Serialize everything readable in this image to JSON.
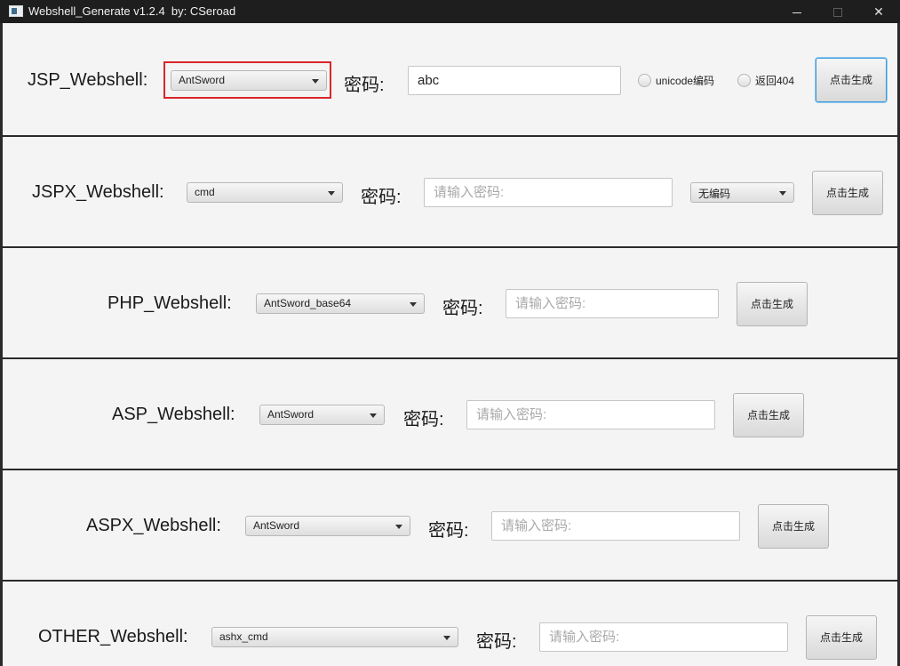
{
  "window": {
    "title": "Webshell_Generate v1.2.4  by: CSeroad",
    "minimize_label": "—",
    "close_label": "✕"
  },
  "icons": {
    "app": "app-window-icon",
    "dropdown": "chevron-down-icon"
  },
  "common": {
    "password_label": "密码:",
    "password_placeholder": "请输入密码:",
    "generate_label": "点击生成"
  },
  "jsp": {
    "label": "JSP_Webshell:",
    "type": "AntSword",
    "password_value": "abc",
    "option_unicode": "unicode编码",
    "option_404": "返回404"
  },
  "jspx": {
    "label": "JSPX_Webshell:",
    "type": "cmd",
    "encoding": "无编码"
  },
  "php": {
    "label": "PHP_Webshell:",
    "type": "AntSword_base64"
  },
  "asp": {
    "label": "ASP_Webshell:",
    "type": "AntSword"
  },
  "aspx": {
    "label": "ASPX_Webshell:",
    "type": "AntSword"
  },
  "other": {
    "label": "OTHER_Webshell:",
    "type": "ashx_cmd"
  },
  "colors": {
    "highlight": "#d9252a",
    "focus": "#3b99d9"
  }
}
